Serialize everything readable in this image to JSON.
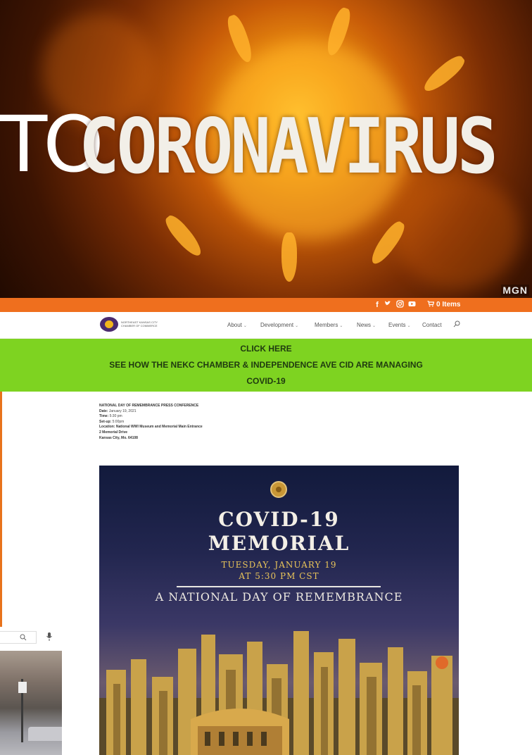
{
  "hero": {
    "partial_word": "TO",
    "title": "CORONAVIRUS",
    "watermark": "MGN"
  },
  "top_strip": {
    "social_icons": [
      "facebook-icon",
      "twitter-icon",
      "instagram-icon",
      "youtube-icon"
    ],
    "cart_label": "0 Items",
    "background": "#ef6f1e"
  },
  "header": {
    "logo_line1": "NORTHEAST KANSAS CITY",
    "logo_line2": "CHAMBER OF COMMERCE",
    "nav": [
      {
        "label": "About",
        "dropdown": true
      },
      {
        "label": "Development",
        "dropdown": true
      },
      {
        "label": "Members",
        "dropdown": true
      },
      {
        "label": "News",
        "dropdown": true
      },
      {
        "label": "Events",
        "dropdown": true
      },
      {
        "label": "Contact",
        "dropdown": false
      }
    ]
  },
  "covid_banner": {
    "line1": "CLICK HERE",
    "line2": "SEE HOW THE NEKC CHAMBER & INDEPENDENCE AVE CID ARE MANAGING",
    "line3": "COVID-19",
    "background": "#7ed321"
  },
  "press": {
    "heading": "NATIONAL DAY OF REMEMBRANCE PRESS CONFERENCE",
    "date_label": "Date:",
    "date_value": "January 19, 2021",
    "time_label": "Time:",
    "time_value": "5:30 pm",
    "setup_label": "Set-up:",
    "setup_value": "5:00pm",
    "location_label": "Location:",
    "location_value": "National WWI Museum and Memorial Main Entrance",
    "address1": "2 Memorial Drive",
    "address2": "Kansas City, Mo. 64108"
  },
  "poster": {
    "title1": "COVID-19",
    "title2": "MEMORIAL",
    "date1": "TUESDAY, JANUARY 19",
    "date2": "AT 5:30 PM CST",
    "subtitle": "A NATIONAL DAY OF REMEMBRANCE"
  }
}
